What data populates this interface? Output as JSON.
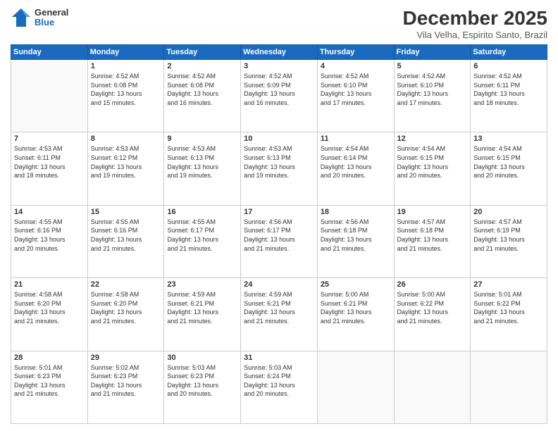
{
  "header": {
    "logo_general": "General",
    "logo_blue": "Blue",
    "month_title": "December 2025",
    "location": "Vila Velha, Espirito Santo, Brazil"
  },
  "days_of_week": [
    "Sunday",
    "Monday",
    "Tuesday",
    "Wednesday",
    "Thursday",
    "Friday",
    "Saturday"
  ],
  "weeks": [
    [
      {
        "day": "",
        "info": ""
      },
      {
        "day": "1",
        "info": "Sunrise: 4:52 AM\nSunset: 6:08 PM\nDaylight: 13 hours\nand 15 minutes."
      },
      {
        "day": "2",
        "info": "Sunrise: 4:52 AM\nSunset: 6:08 PM\nDaylight: 13 hours\nand 16 minutes."
      },
      {
        "day": "3",
        "info": "Sunrise: 4:52 AM\nSunset: 6:09 PM\nDaylight: 13 hours\nand 16 minutes."
      },
      {
        "day": "4",
        "info": "Sunrise: 4:52 AM\nSunset: 6:10 PM\nDaylight: 13 hours\nand 17 minutes."
      },
      {
        "day": "5",
        "info": "Sunrise: 4:52 AM\nSunset: 6:10 PM\nDaylight: 13 hours\nand 17 minutes."
      },
      {
        "day": "6",
        "info": "Sunrise: 4:52 AM\nSunset: 6:11 PM\nDaylight: 13 hours\nand 18 minutes."
      }
    ],
    [
      {
        "day": "7",
        "info": "Sunrise: 4:53 AM\nSunset: 6:11 PM\nDaylight: 13 hours\nand 18 minutes."
      },
      {
        "day": "8",
        "info": "Sunrise: 4:53 AM\nSunset: 6:12 PM\nDaylight: 13 hours\nand 19 minutes."
      },
      {
        "day": "9",
        "info": "Sunrise: 4:53 AM\nSunset: 6:13 PM\nDaylight: 13 hours\nand 19 minutes."
      },
      {
        "day": "10",
        "info": "Sunrise: 4:53 AM\nSunset: 6:13 PM\nDaylight: 13 hours\nand 19 minutes."
      },
      {
        "day": "11",
        "info": "Sunrise: 4:54 AM\nSunset: 6:14 PM\nDaylight: 13 hours\nand 20 minutes."
      },
      {
        "day": "12",
        "info": "Sunrise: 4:54 AM\nSunset: 6:15 PM\nDaylight: 13 hours\nand 20 minutes."
      },
      {
        "day": "13",
        "info": "Sunrise: 4:54 AM\nSunset: 6:15 PM\nDaylight: 13 hours\nand 20 minutes."
      }
    ],
    [
      {
        "day": "14",
        "info": "Sunrise: 4:55 AM\nSunset: 6:16 PM\nDaylight: 13 hours\nand 20 minutes."
      },
      {
        "day": "15",
        "info": "Sunrise: 4:55 AM\nSunset: 6:16 PM\nDaylight: 13 hours\nand 21 minutes."
      },
      {
        "day": "16",
        "info": "Sunrise: 4:55 AM\nSunset: 6:17 PM\nDaylight: 13 hours\nand 21 minutes."
      },
      {
        "day": "17",
        "info": "Sunrise: 4:56 AM\nSunset: 6:17 PM\nDaylight: 13 hours\nand 21 minutes."
      },
      {
        "day": "18",
        "info": "Sunrise: 4:56 AM\nSunset: 6:18 PM\nDaylight: 13 hours\nand 21 minutes."
      },
      {
        "day": "19",
        "info": "Sunrise: 4:57 AM\nSunset: 6:18 PM\nDaylight: 13 hours\nand 21 minutes."
      },
      {
        "day": "20",
        "info": "Sunrise: 4:57 AM\nSunset: 6:19 PM\nDaylight: 13 hours\nand 21 minutes."
      }
    ],
    [
      {
        "day": "21",
        "info": "Sunrise: 4:58 AM\nSunset: 6:20 PM\nDaylight: 13 hours\nand 21 minutes."
      },
      {
        "day": "22",
        "info": "Sunrise: 4:58 AM\nSunset: 6:20 PM\nDaylight: 13 hours\nand 21 minutes."
      },
      {
        "day": "23",
        "info": "Sunrise: 4:59 AM\nSunset: 6:21 PM\nDaylight: 13 hours\nand 21 minutes."
      },
      {
        "day": "24",
        "info": "Sunrise: 4:59 AM\nSunset: 6:21 PM\nDaylight: 13 hours\nand 21 minutes."
      },
      {
        "day": "25",
        "info": "Sunrise: 5:00 AM\nSunset: 6:21 PM\nDaylight: 13 hours\nand 21 minutes."
      },
      {
        "day": "26",
        "info": "Sunrise: 5:00 AM\nSunset: 6:22 PM\nDaylight: 13 hours\nand 21 minutes."
      },
      {
        "day": "27",
        "info": "Sunrise: 5:01 AM\nSunset: 6:22 PM\nDaylight: 13 hours\nand 21 minutes."
      }
    ],
    [
      {
        "day": "28",
        "info": "Sunrise: 5:01 AM\nSunset: 6:23 PM\nDaylight: 13 hours\nand 21 minutes."
      },
      {
        "day": "29",
        "info": "Sunrise: 5:02 AM\nSunset: 6:23 PM\nDaylight: 13 hours\nand 21 minutes."
      },
      {
        "day": "30",
        "info": "Sunrise: 5:03 AM\nSunset: 6:23 PM\nDaylight: 13 hours\nand 20 minutes."
      },
      {
        "day": "31",
        "info": "Sunrise: 5:03 AM\nSunset: 6:24 PM\nDaylight: 13 hours\nand 20 minutes."
      },
      {
        "day": "",
        "info": ""
      },
      {
        "day": "",
        "info": ""
      },
      {
        "day": "",
        "info": ""
      }
    ]
  ]
}
